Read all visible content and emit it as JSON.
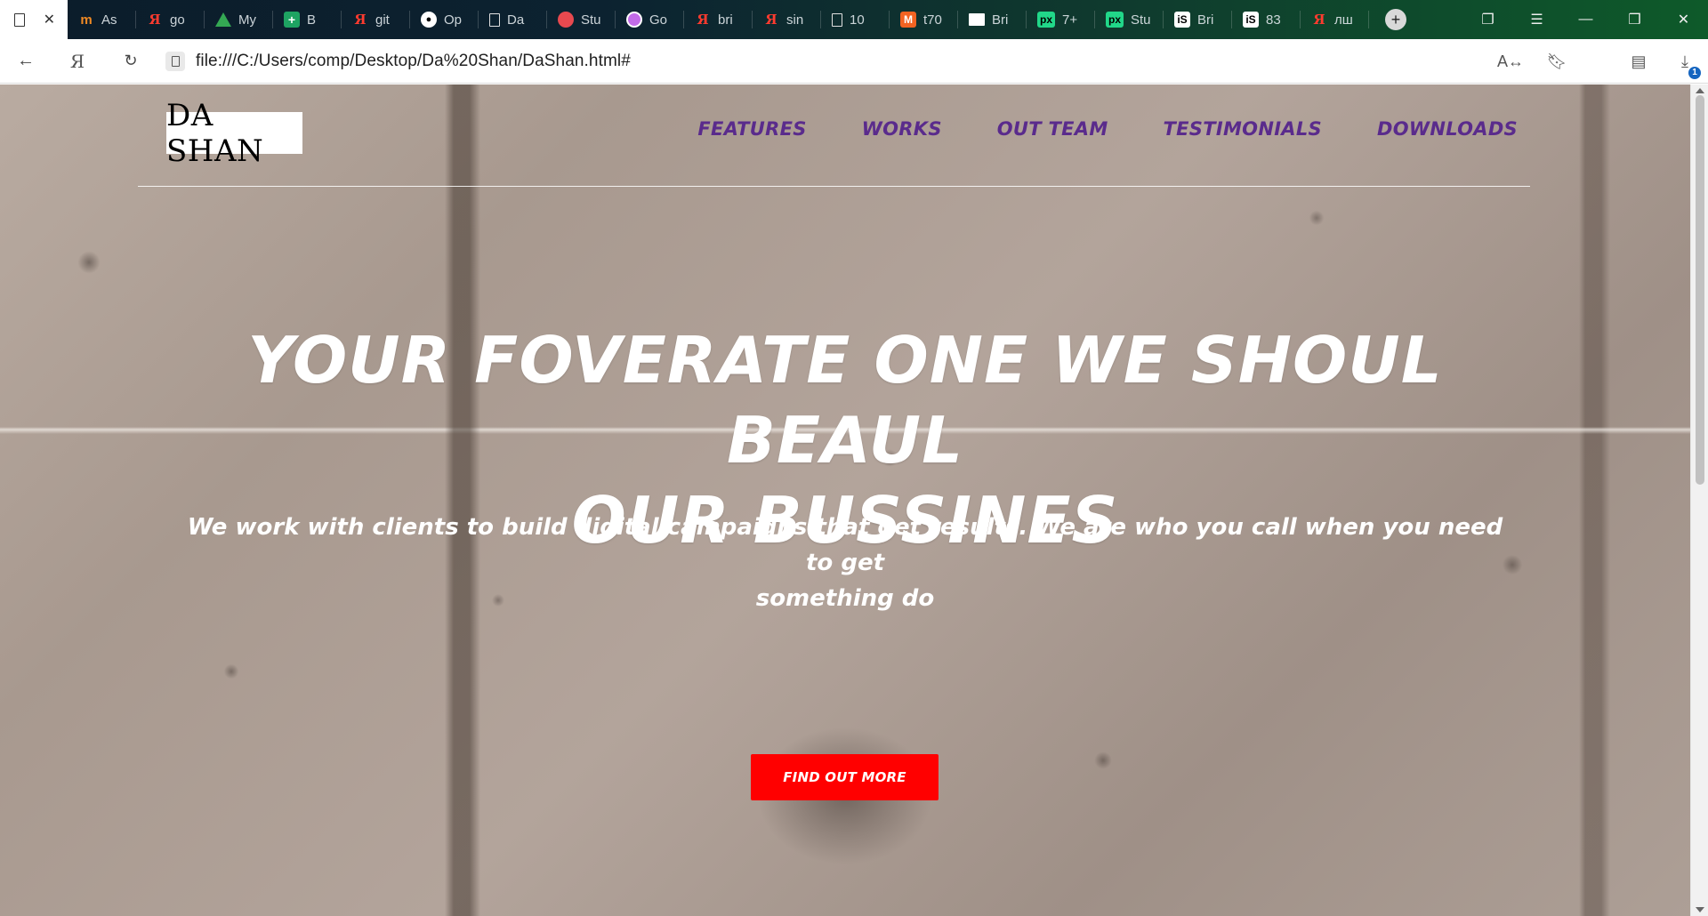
{
  "browser": {
    "tabs": [
      {
        "icon": "magento-m-icon",
        "label": "As"
      },
      {
        "icon": "yandex-icon",
        "label": "go"
      },
      {
        "icon": "google-drive-icon",
        "label": "My"
      },
      {
        "icon": "google-sheets-icon",
        "label": "B"
      },
      {
        "icon": "yandex-icon",
        "label": "git"
      },
      {
        "icon": "github-icon",
        "label": "Op"
      },
      {
        "icon": "document-icon",
        "label": "Da"
      },
      {
        "icon": "stu-icon",
        "label": "Stu"
      },
      {
        "icon": "circle-icon",
        "label": "Go"
      },
      {
        "icon": "yandex-icon",
        "label": "bri"
      },
      {
        "icon": "yandex-icon",
        "label": "sin"
      },
      {
        "icon": "document-icon",
        "label": "10"
      },
      {
        "icon": "magento-icon",
        "label": "t70"
      },
      {
        "icon": "bri-icon",
        "label": "Bri"
      },
      {
        "icon": "px-icon",
        "label": "7+"
      },
      {
        "icon": "px-icon",
        "label": "Stu"
      },
      {
        "icon": "is-icon",
        "label": "Bri"
      },
      {
        "icon": "is-icon",
        "label": "83"
      },
      {
        "icon": "yandex-icon",
        "label": "лш"
      }
    ],
    "address": {
      "url": "file:///C:/Users/comp/Desktop/Da%20Shan/DaShan.html#",
      "downloads_badge": "1"
    }
  },
  "site": {
    "logo": "DA SHAN",
    "nav": [
      "FEATURES",
      "WORKS",
      "OUT TEAM",
      "TESTIMONIALS",
      "DOWNLOADS"
    ],
    "hero": {
      "title_line1": "YOUR FOVERATE ONE WE SHOUL BEAUL",
      "title_line2": "OUR BUSSINES",
      "subtitle_line1": "We work with clients to build digital campaigns that get results. We are who you call when you need to get",
      "subtitle_line2": "something do",
      "cta_label": "FIND OUT MORE"
    }
  },
  "colors": {
    "nav_link": "#5a2b8c",
    "cta_bg": "#ff0000",
    "hero_text": "#ffffff"
  }
}
